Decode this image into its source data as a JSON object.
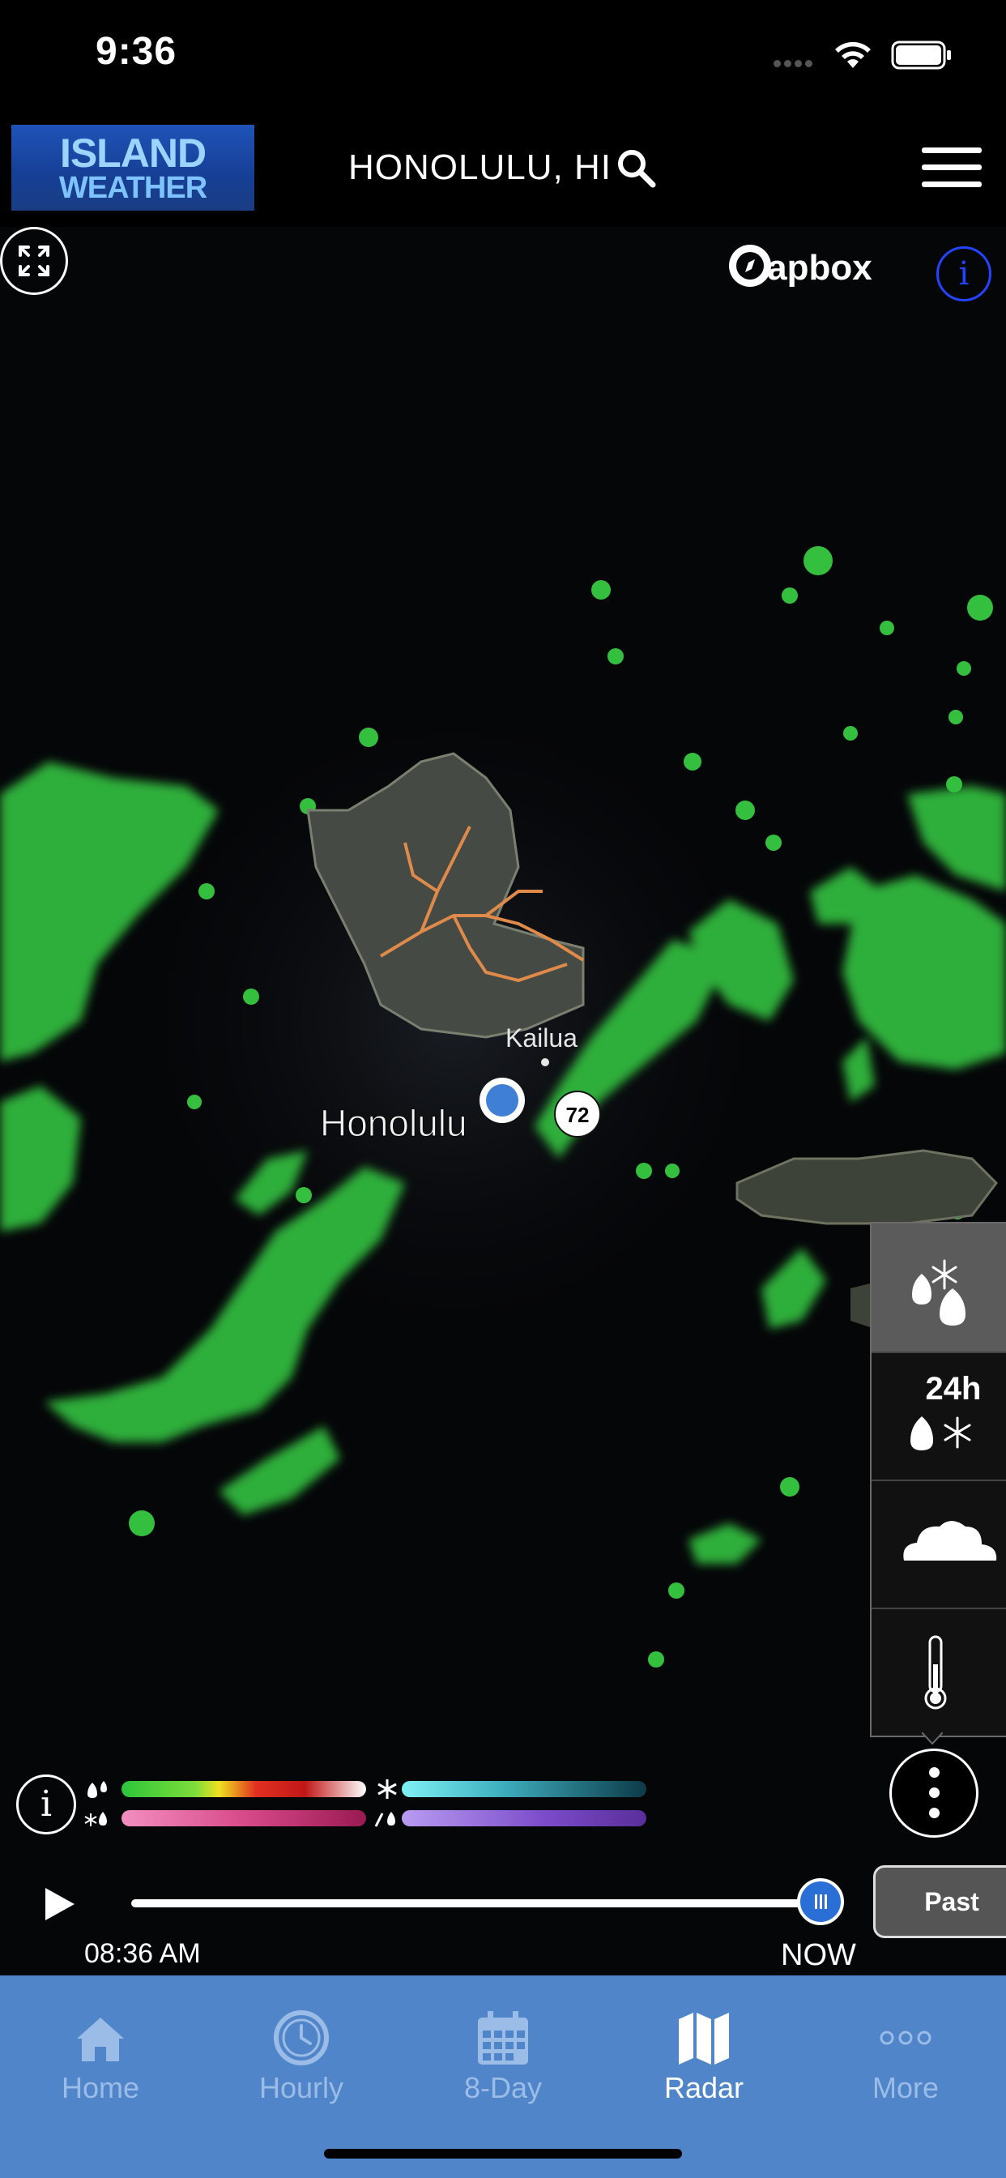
{
  "status_bar": {
    "time": "9:36"
  },
  "header": {
    "logo_line1": "ISLAND",
    "logo_line2": "WEATHER",
    "location": "HONOLULU, HI"
  },
  "map": {
    "attribution": "mapbox",
    "labels": {
      "city": "Honolulu",
      "town": "Kailua",
      "route": "72"
    }
  },
  "layers": {
    "items": [
      {
        "name": "radar-precip",
        "label": "",
        "active": true
      },
      {
        "name": "24h-precip",
        "label": "24h",
        "active": false
      },
      {
        "name": "clouds",
        "label": "",
        "active": false
      },
      {
        "name": "temperature",
        "label": "",
        "active": false
      }
    ]
  },
  "legend": {
    "rain_colors": [
      "#2cc43a",
      "#7ddc3a",
      "#f0e020",
      "#e03020",
      "#ffffff"
    ],
    "snow_colors": [
      "#7ff0f4",
      "#2a8a9a",
      "#0c3a48"
    ],
    "mix_colors": [
      "#f28fc0",
      "#9a1a52"
    ],
    "ice_colors": [
      "#b89cf2",
      "#5a2e9a"
    ]
  },
  "timeline": {
    "start_time": "08:36 AM",
    "now_label": "NOW",
    "past_label": "Past",
    "progress": 1.0
  },
  "tabs": [
    {
      "label": "Home",
      "icon": "home-icon",
      "active": false
    },
    {
      "label": "Hourly",
      "icon": "clock-icon",
      "active": false
    },
    {
      "label": "8-Day",
      "icon": "calendar-icon",
      "active": false
    },
    {
      "label": "Radar",
      "icon": "map-icon",
      "active": true
    },
    {
      "label": "More",
      "icon": "more-dots-icon",
      "active": false
    }
  ],
  "colors": {
    "tab_bar": "#5086c9",
    "radar_green": "#2cc43a",
    "location_dot": "#3f7fd6"
  }
}
